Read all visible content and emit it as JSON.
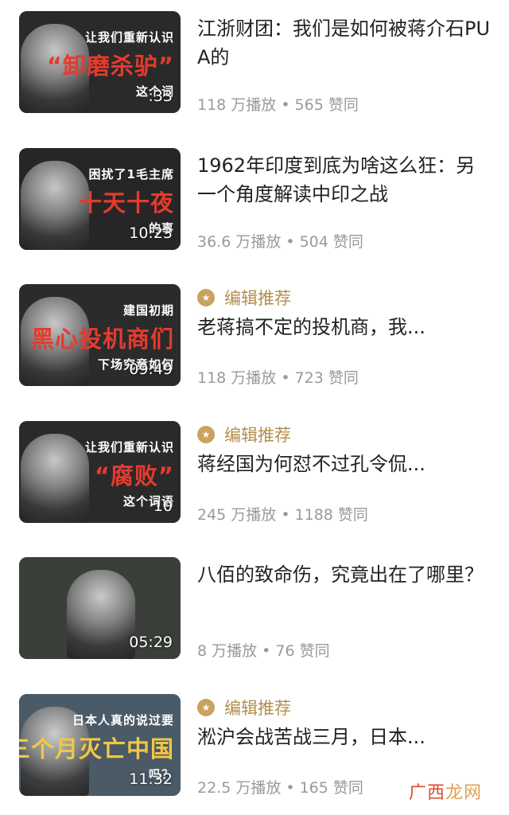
{
  "items": [
    {
      "title": "江浙财团：我们是如何被蒋介石PUA的",
      "views": "118 万播放",
      "likes": "565 赞同",
      "duration": ":33",
      "recommended": false,
      "thumb": {
        "cap1": "让我们重新认识",
        "cap2": "“卸磨杀驴”",
        "cap3": "这个词",
        "cap2_color": "#e63a2e",
        "bg": "#2a2a2a"
      }
    },
    {
      "title": "1962年印度到底为啥这么狂：另一个角度解读中印之战",
      "views": "36.6 万播放",
      "likes": "504 赞同",
      "duration": "10:23",
      "recommended": false,
      "thumb": {
        "cap1": "困扰了1毛主席",
        "cap2": "十天十夜",
        "cap3": "的事",
        "cap2_color": "#e63a2e",
        "bg": "#262626"
      }
    },
    {
      "title": "老蒋搞不定的投机商，我...",
      "views": "118 万播放",
      "likes": "723 赞同",
      "duration": "09:49",
      "recommended": true,
      "rec_label": "编辑推荐",
      "thumb": {
        "cap1": "建国初期",
        "cap2": "黑心投机商们",
        "cap3": "下场究竟如何",
        "cap2_color": "#e63a2e",
        "bg": "#2b2b2b"
      }
    },
    {
      "title": "蒋经国为何怼不过孔令侃...",
      "views": "245 万播放",
      "likes": "1188 赞同",
      "duration": "10",
      "recommended": true,
      "rec_label": "编辑推荐",
      "thumb": {
        "cap1": "让我们重新认识",
        "cap2": "“腐败”",
        "cap3": "这个词语",
        "cap2_color": "#e63a2e",
        "bg": "#2a2a2a"
      }
    },
    {
      "title": "八佰的致命伤，究竟出在了哪里？",
      "views": "8 万播放",
      "likes": "76 赞同",
      "duration": "05:29",
      "recommended": false,
      "thumb": {
        "cap1": "",
        "cap2": "",
        "cap3": "",
        "cap2_color": "#ffffff",
        "bg": "#3b3f3a"
      }
    },
    {
      "title": "淞沪会战苦战三月，日本...",
      "views": "22.5 万播放",
      "likes": "165 赞同",
      "duration": "11:32",
      "recommended": true,
      "rec_label": "编辑推荐",
      "thumb": {
        "cap1": "日本人真的说过要",
        "cap2": "三个月灭亡中国",
        "cap3": "吗？",
        "cap2_color": "#f2c744",
        "bg": "#4a5a66"
      }
    }
  ],
  "separator": "•",
  "watermark": {
    "part1": "广西",
    "part2": "龙网"
  }
}
